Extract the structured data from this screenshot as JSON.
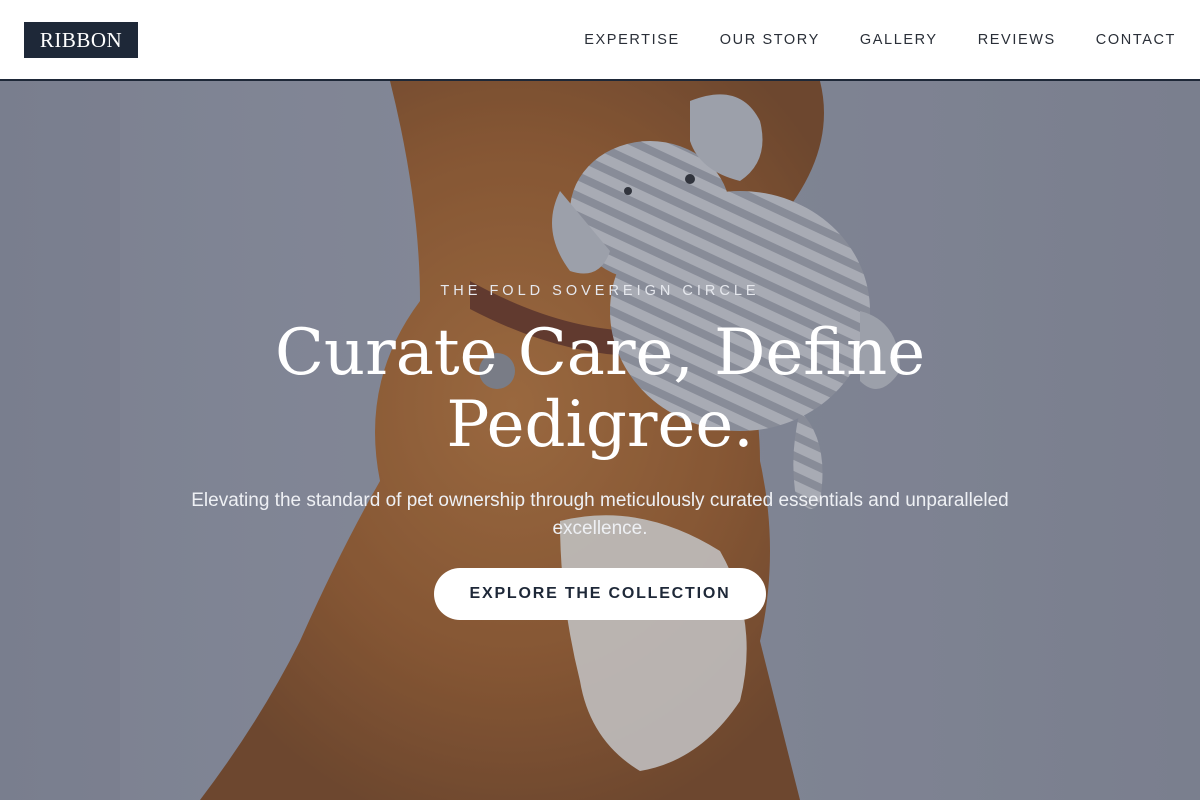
{
  "brand": {
    "logo_text": "RIBBON"
  },
  "nav": {
    "items": [
      {
        "label": "EXPERTISE"
      },
      {
        "label": "OUR STORY"
      },
      {
        "label": "GALLERY"
      },
      {
        "label": "REVIEWS"
      },
      {
        "label": "CONTACT"
      }
    ]
  },
  "hero": {
    "eyebrow": "THE FOLD SOVEREIGN CIRCLE",
    "headline": "Curate Care, Define Pedigree.",
    "subtitle": "Elevating the standard of pet ownership through meticulously curated essentials and unparalleled excellence.",
    "cta_label": "EXPLORE THE COLLECTION",
    "image_subject": "dog-with-plush-elephant-toy"
  },
  "colors": {
    "brand_navy": "#1e2838",
    "hero_backdrop": "#8e93a3",
    "dog_fur": "#a0602a",
    "white": "#ffffff"
  }
}
